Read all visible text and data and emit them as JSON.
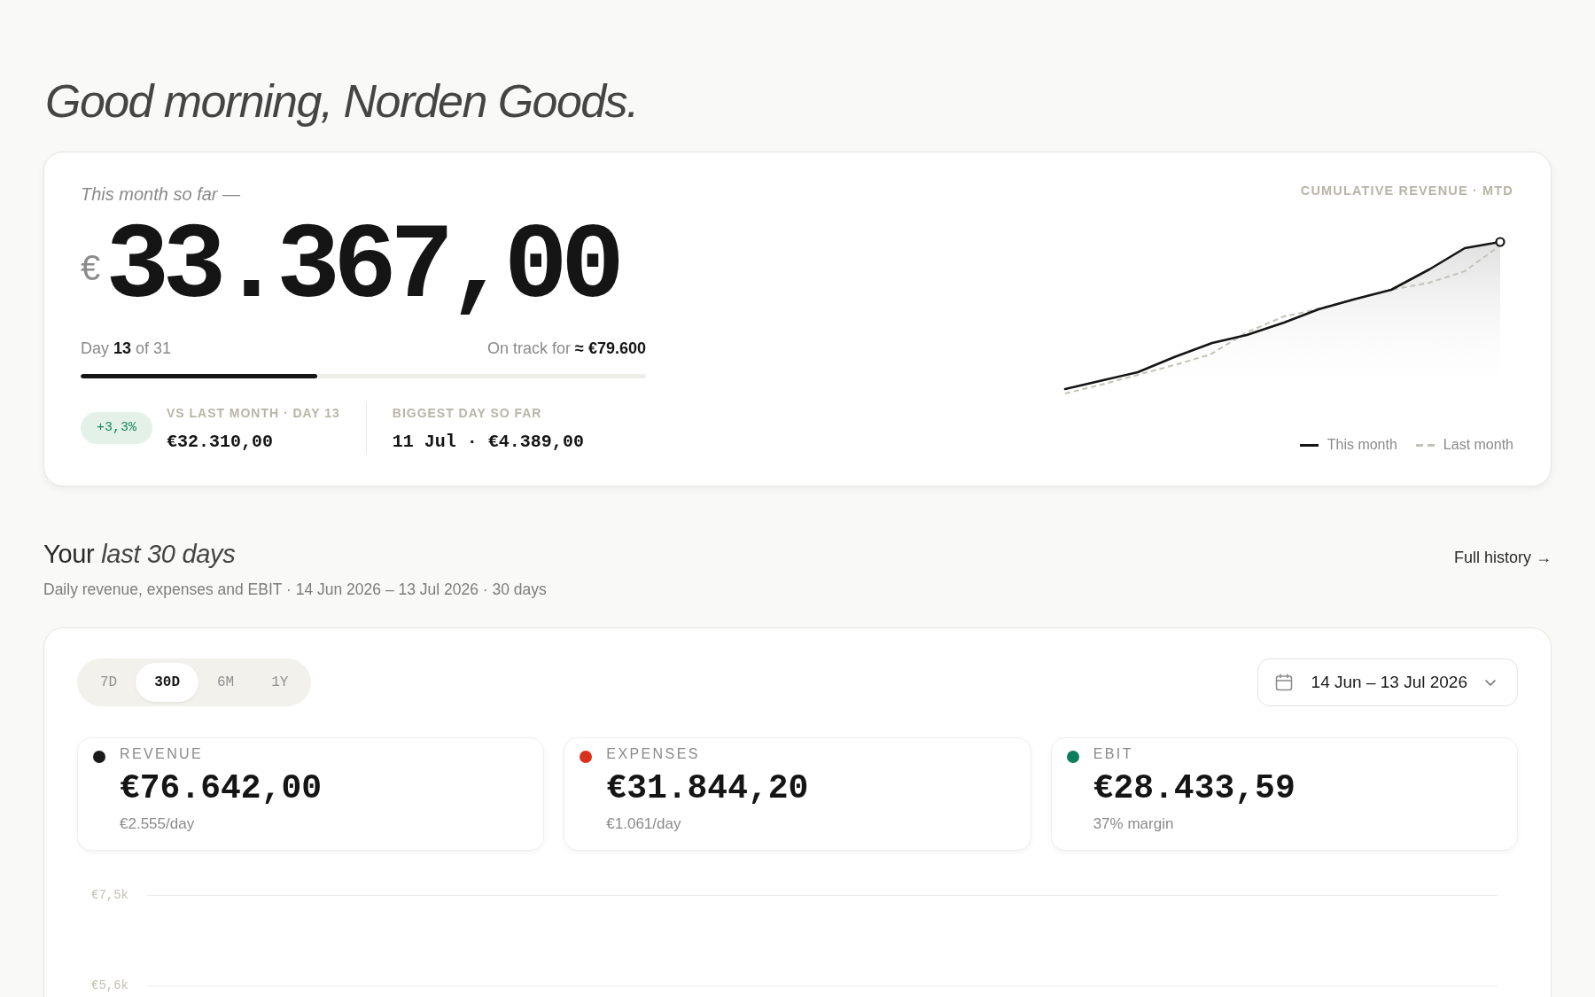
{
  "greeting": "Good morning, Norden Goods.",
  "summary": {
    "caption": "This month so far —",
    "currency": "€",
    "amount": "33.367,00",
    "month_progress": {
      "label": "Day **13** of 31",
      "forecast": "On track for **≈ €79.600**",
      "level": 0.419
    },
    "change_badge": "+3,3%",
    "comparison": {
      "label": "VS LAST MONTH · DAY 13",
      "value": "€32.310,00"
    },
    "biggest_day": {
      "label": "BIGGEST DAY SO FAR",
      "value": "11 Jul · €4.389,00"
    },
    "chart": {
      "title": "CUMULATIVE REVENUE · MTD",
      "legend": [
        {
          "label": "This month",
          "kind": "solid"
        },
        {
          "label": "Last month",
          "kind": "dashed"
        }
      ]
    }
  },
  "section": {
    "title": "Your *last 30 days*",
    "subtitle": "Daily revenue, expenses and EBIT · 14 Jun 2026 – 13 Jul 2026 · 30 days",
    "link": "Full history →"
  },
  "range_tabs": [
    {
      "label": "7D",
      "selected": false
    },
    {
      "label": "30D",
      "selected": true
    },
    {
      "label": "6M",
      "selected": false
    },
    {
      "label": "1Y",
      "selected": false
    }
  ],
  "date_range": {
    "label": "14 Jun – 13 Jul 2026"
  },
  "metrics": [
    {
      "label": "REVENUE",
      "color": "#1a1a1a",
      "value": "€76.642,00",
      "note": "€2.555/day"
    },
    {
      "label": "EXPENSES",
      "color": "#d8321c",
      "value": "€31.844,20",
      "note": "€1.061/day"
    },
    {
      "label": "EBIT",
      "color": "#0b7f5c",
      "value": "€28.433,59",
      "note": "37% margin"
    }
  ],
  "daily_chart": {
    "gridlines": [
      {
        "label": "€7,5k"
      },
      {
        "label": "€5,6k"
      }
    ]
  }
}
